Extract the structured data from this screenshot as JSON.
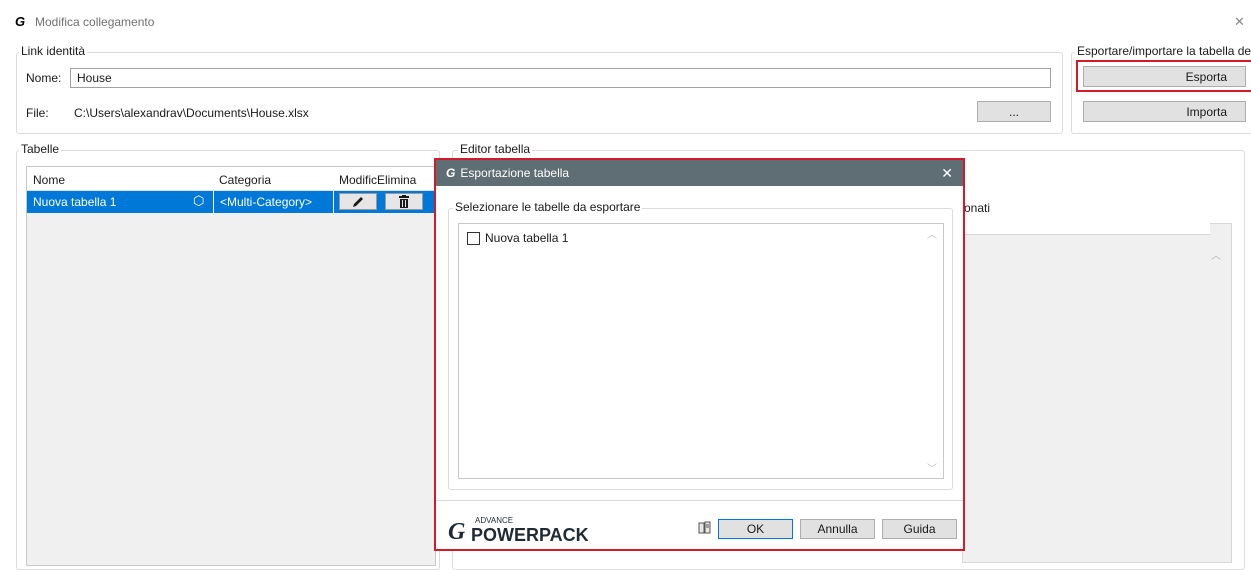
{
  "window": {
    "title": "Modifica collegamento",
    "close_glyph": "✕"
  },
  "link_identity": {
    "legend": "Link identità",
    "name_label": "Nome:",
    "name_value": "House",
    "file_label": "File:",
    "file_value": "C:\\Users\\alexandrav\\Documents\\House.xlsx",
    "browse_label": "..."
  },
  "export_import": {
    "legend": "Esportare/importare la tabella de",
    "export_label": "Esporta",
    "import_label": "Importa"
  },
  "tables": {
    "legend": "Tabelle",
    "columns": [
      "Nome",
      "Categoria",
      "Modific",
      "Elimina"
    ],
    "rows": [
      {
        "name": "Nuova tabella 1",
        "category": "<Multi-Category>"
      }
    ]
  },
  "table_editor": {
    "legend": "Editor tabella",
    "partial_label": "onati"
  },
  "export_dialog": {
    "title": "Esportazione tabella",
    "group_legend": "Selezionare le tabelle da esportare",
    "items": [
      {
        "label": "Nuova tabella 1",
        "checked": false
      }
    ],
    "brand_small": "ADVANCE",
    "brand_big": "POWERPACK",
    "ok_label": "OK",
    "cancel_label": "Annulla",
    "help_label": "Guida",
    "close_glyph": "✕"
  },
  "colors": {
    "accent_red": "#d21a2a",
    "selection_blue": "#0078d7",
    "dialog_titlebar": "#5f6d74"
  }
}
